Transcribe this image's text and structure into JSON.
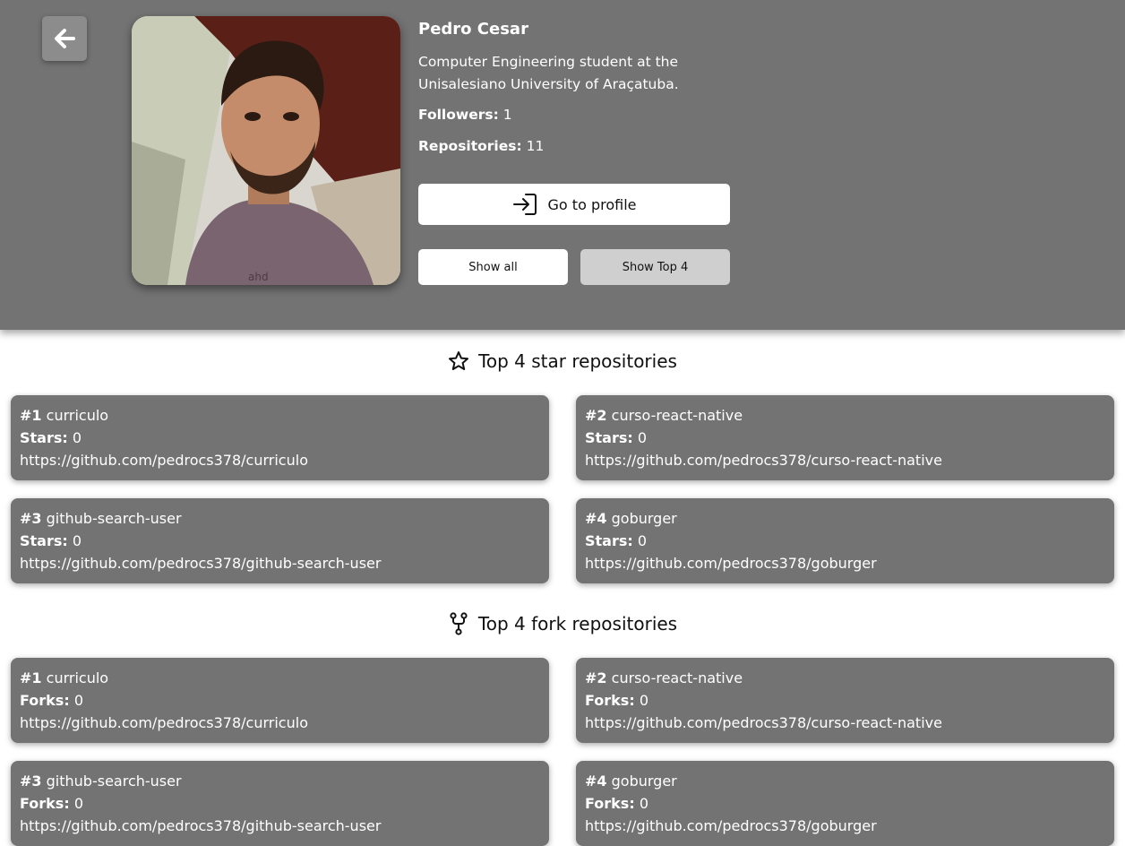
{
  "user": {
    "name": "Pedro Cesar",
    "bio": "Computer Engineering student at the Unisalesiano University of Araçatuba.",
    "followers_label": "Followers:",
    "followers": "1",
    "repositories_label": "Repositories:",
    "repositories": "11"
  },
  "buttons": {
    "back_icon": "arrow-left-icon",
    "go_to_profile": "Go to profile",
    "go_to_profile_icon": "login-icon",
    "show_all": "Show all",
    "show_top": "Show Top 4"
  },
  "colors": {
    "header_bg": "#737373",
    "card_bg": "#737373",
    "active_toggle": "#cfcfcf"
  },
  "star_section": {
    "icon": "star-icon",
    "title": "Top 4 star repositories",
    "metric_label": "Stars:",
    "repos": [
      {
        "rank": "#1",
        "name": "curriculo",
        "count": "0",
        "url": "https://github.com/pedrocs378/curriculo"
      },
      {
        "rank": "#2",
        "name": "curso-react-native",
        "count": "0",
        "url": "https://github.com/pedrocs378/curso-react-native"
      },
      {
        "rank": "#3",
        "name": "github-search-user",
        "count": "0",
        "url": "https://github.com/pedrocs378/github-search-user"
      },
      {
        "rank": "#4",
        "name": "goburger",
        "count": "0",
        "url": "https://github.com/pedrocs378/goburger"
      }
    ]
  },
  "fork_section": {
    "icon": "fork-icon",
    "title": "Top 4 fork repositories",
    "metric_label": "Forks:",
    "repos": [
      {
        "rank": "#1",
        "name": "curriculo",
        "count": "0",
        "url": "https://github.com/pedrocs378/curriculo"
      },
      {
        "rank": "#2",
        "name": "curso-react-native",
        "count": "0",
        "url": "https://github.com/pedrocs378/curso-react-native"
      },
      {
        "rank": "#3",
        "name": "github-search-user",
        "count": "0",
        "url": "https://github.com/pedrocs378/github-search-user"
      },
      {
        "rank": "#4",
        "name": "goburger",
        "count": "0",
        "url": "https://github.com/pedrocs378/goburger"
      }
    ]
  }
}
